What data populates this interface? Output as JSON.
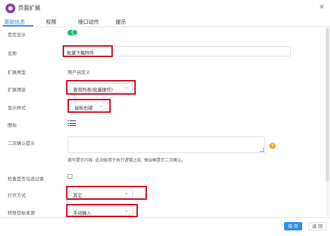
{
  "window": {
    "title": "页面扩展"
  },
  "tabs": [
    {
      "label": "基础信息",
      "active": true
    },
    {
      "label": "权限",
      "active": false
    },
    {
      "label": "接口动作",
      "active": false
    },
    {
      "label": "提示",
      "active": false
    }
  ],
  "form": {
    "visible_label": "是否显示",
    "visible_on": true,
    "name_label": "名称",
    "name_value": "批量下载附件",
    "ext_type_label": "扩展类型",
    "ext_type_value": "用户自定义",
    "ext_use_label": "扩展用途",
    "ext_use_value": "查询列表(批量操作)",
    "display_style_label": "显示样式",
    "display_style_value": "鼠标右键",
    "icon_label": "图标",
    "icon_name": "list-icon",
    "confirm_label": "二次确认提示",
    "confirm_value": "",
    "confirm_hint": "填写提示内容, 此功能用于执行逻辑之前, 弹出框提示二次确认。",
    "check_selected_label": "检查是否勾选记录",
    "check_selected_checked": false,
    "open_mode_label": "打开方式",
    "open_mode_value": "其它",
    "target_source_label": "转移目标来源",
    "target_source_value": "手动输入"
  },
  "footer": {
    "save_label": "保 存",
    "back_label": "返 回"
  },
  "colors": {
    "accent": "#2d8cf0",
    "toggle": "#19be6b",
    "highlight": "#d0021b",
    "help": "#f7a21d"
  }
}
